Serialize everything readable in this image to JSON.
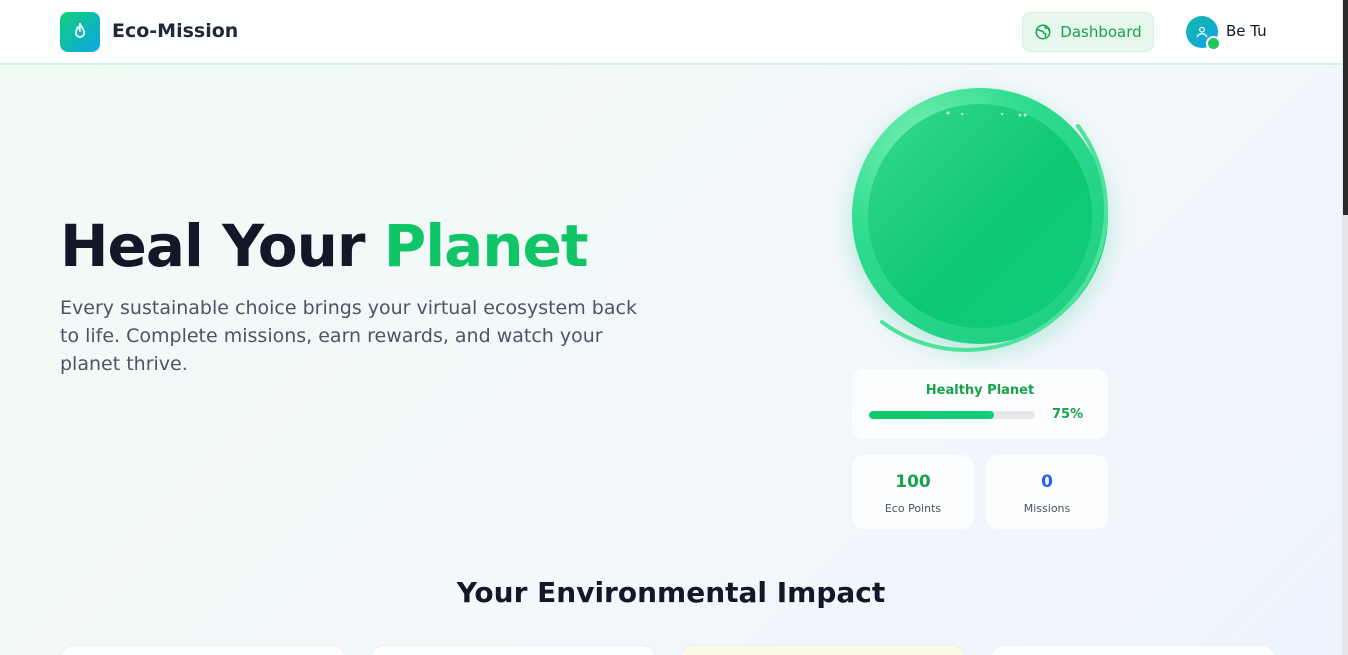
{
  "header": {
    "brand": "Eco-Mission",
    "dashboard_label": "Dashboard",
    "user_name": "Be Tu",
    "icons": {
      "logo": "flame-icon",
      "dashboard": "globe-icon",
      "avatar": "user-icon"
    }
  },
  "hero": {
    "title_part1": "Heal Your ",
    "title_part2": "Planet",
    "subtitle": "Every sustainable choice brings your virtual ecosystem back to life. Complete missions, earn rewards, and watch your planet thrive."
  },
  "planet": {
    "status_label": "Healthy Planet",
    "health_percent": 75,
    "health_percent_label": "75%"
  },
  "stats": [
    {
      "value": "100",
      "label": "Eco Points",
      "color": "#16a34a"
    },
    {
      "value": "0",
      "label": "Missions",
      "color": "#2563eb"
    }
  ],
  "section": {
    "title": "Your Environmental Impact"
  },
  "colors": {
    "accent": "#10c568",
    "brand_gradient_start": "#10d07a",
    "brand_gradient_end": "#0ea5e9"
  }
}
